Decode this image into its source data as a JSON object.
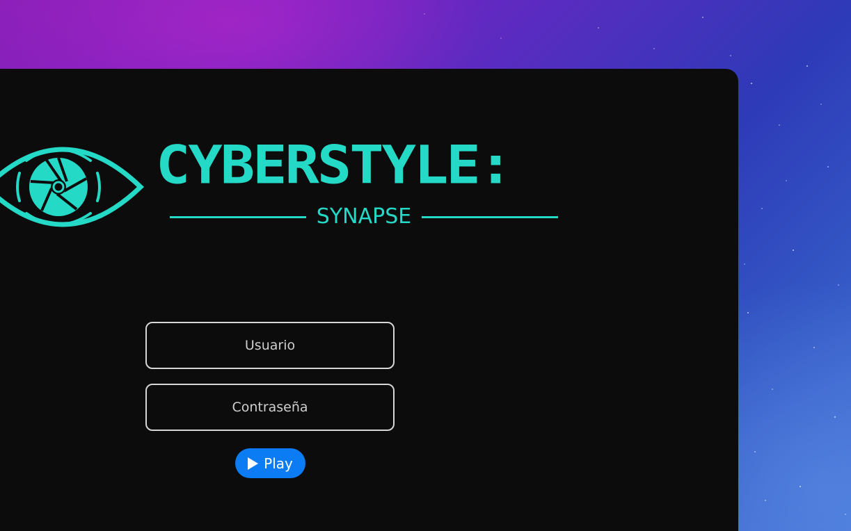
{
  "logo": {
    "title": "CYBERSTYLE:",
    "subtitle": "SYNAPSE",
    "icon": "eye-aperture-icon"
  },
  "login": {
    "username_placeholder": "Usuario",
    "password_placeholder": "Contraseña",
    "play_label": "Play",
    "play_icon": "play-icon"
  },
  "colors": {
    "accent": "#25d9c7",
    "button": "#0b7cf3",
    "window_bg": "#0c0c0c",
    "field_border": "#d7d7d7"
  }
}
